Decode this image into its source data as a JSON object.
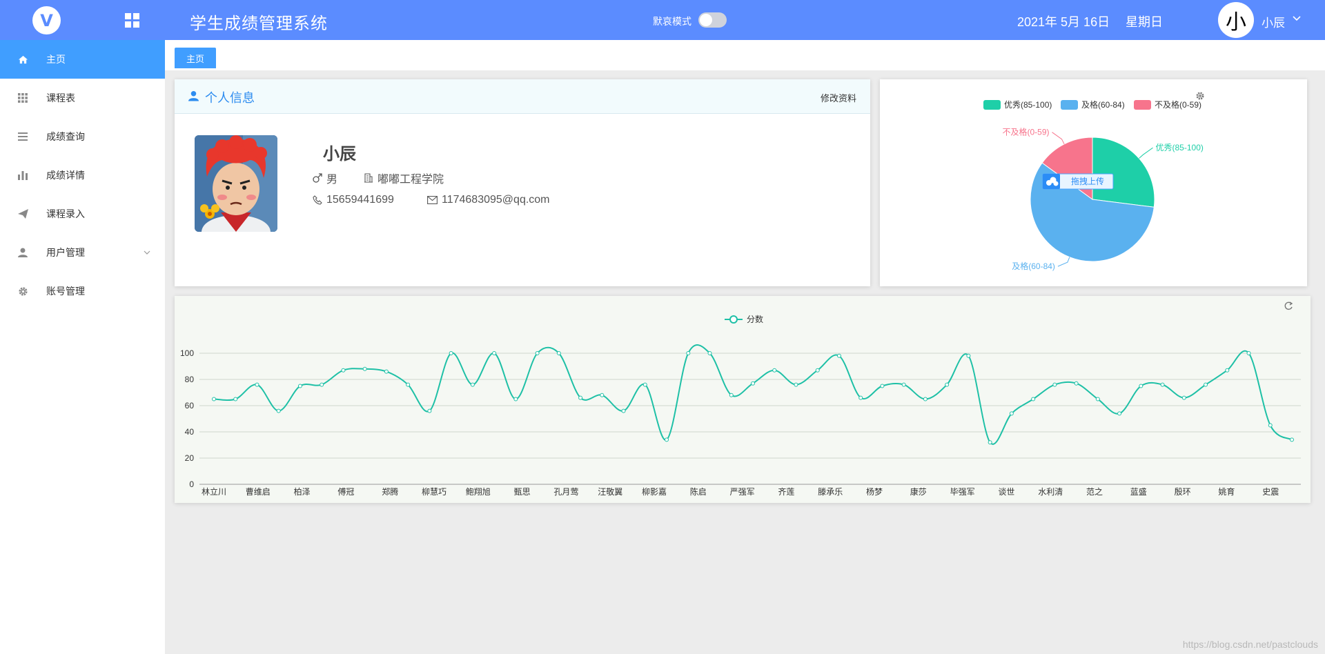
{
  "header": {
    "logo_letter": "V",
    "title": "学生成绩管理系统",
    "mode_label": "默哀模式",
    "date": "2021年 5月 16日",
    "weekday": "星期日",
    "avatar_char": "小",
    "user_name": "小辰",
    "accent_color": "#5b8cff"
  },
  "sidebar": {
    "items": [
      {
        "label": "主页",
        "icon": "home-icon",
        "active": true
      },
      {
        "label": "课程表",
        "icon": "grid-icon"
      },
      {
        "label": "成绩查询",
        "icon": "list-icon"
      },
      {
        "label": "成绩详情",
        "icon": "bar-chart-icon"
      },
      {
        "label": "课程录入",
        "icon": "send-icon"
      },
      {
        "label": "用户管理",
        "icon": "user-icon",
        "has_children": true
      },
      {
        "label": "账号管理",
        "icon": "gear-icon"
      }
    ]
  },
  "tabs": [
    {
      "label": "主页"
    }
  ],
  "profile": {
    "title": "个人信息",
    "edit_label": "修改资料",
    "name": "小辰",
    "gender": "男",
    "school": "嘟嘟工程学院",
    "phone": "15659441699",
    "email": "1174683095@qq.com"
  },
  "pie": {
    "upload_label": "拖拽上传",
    "chart_data": {
      "type": "pie",
      "slices": [
        {
          "name": "优秀(85-100)",
          "value": 27,
          "color": "#1ecfa8"
        },
        {
          "name": "及格(60-84)",
          "value": 58,
          "color": "#5ab1ef"
        },
        {
          "name": "不及格(0-59)",
          "value": 15,
          "color": "#f7748c"
        }
      ],
      "legend": "top-center"
    }
  },
  "line": {
    "chart_data": {
      "type": "line",
      "legend_name": "分数",
      "legend": "top-center",
      "series_color": "#1ec0a6",
      "ylim": [
        0,
        100
      ],
      "yticks": [
        0,
        20,
        40,
        60,
        80,
        100
      ],
      "xlabels": [
        "林立川",
        "曹维启",
        "柏泽",
        "傅冠",
        "郑腾",
        "柳慧巧",
        "鲍翔旭",
        "甄思",
        "孔月莺",
        "汪敬翼",
        "柳影嘉",
        "陈启",
        "严强军",
        "齐莲",
        "滕承乐",
        "杨梦",
        "康莎",
        "毕强军",
        "谈世",
        "水利清",
        "范之",
        "蓝盛",
        "殷环",
        "姚育",
        "史震"
      ],
      "values": [
        65,
        65,
        76,
        56,
        75,
        76,
        87,
        88,
        86,
        76,
        56,
        100,
        76,
        100,
        65,
        100,
        100,
        66,
        68,
        56,
        76,
        34,
        100,
        100,
        68,
        77,
        87,
        76,
        87,
        98,
        66,
        75,
        76,
        65,
        76,
        98,
        32,
        54,
        65,
        76,
        77,
        65,
        54,
        75,
        76,
        66,
        76,
        87,
        100,
        45,
        34
      ],
      "grid": true
    }
  },
  "watermark": "https://blog.csdn.net/pastclouds"
}
